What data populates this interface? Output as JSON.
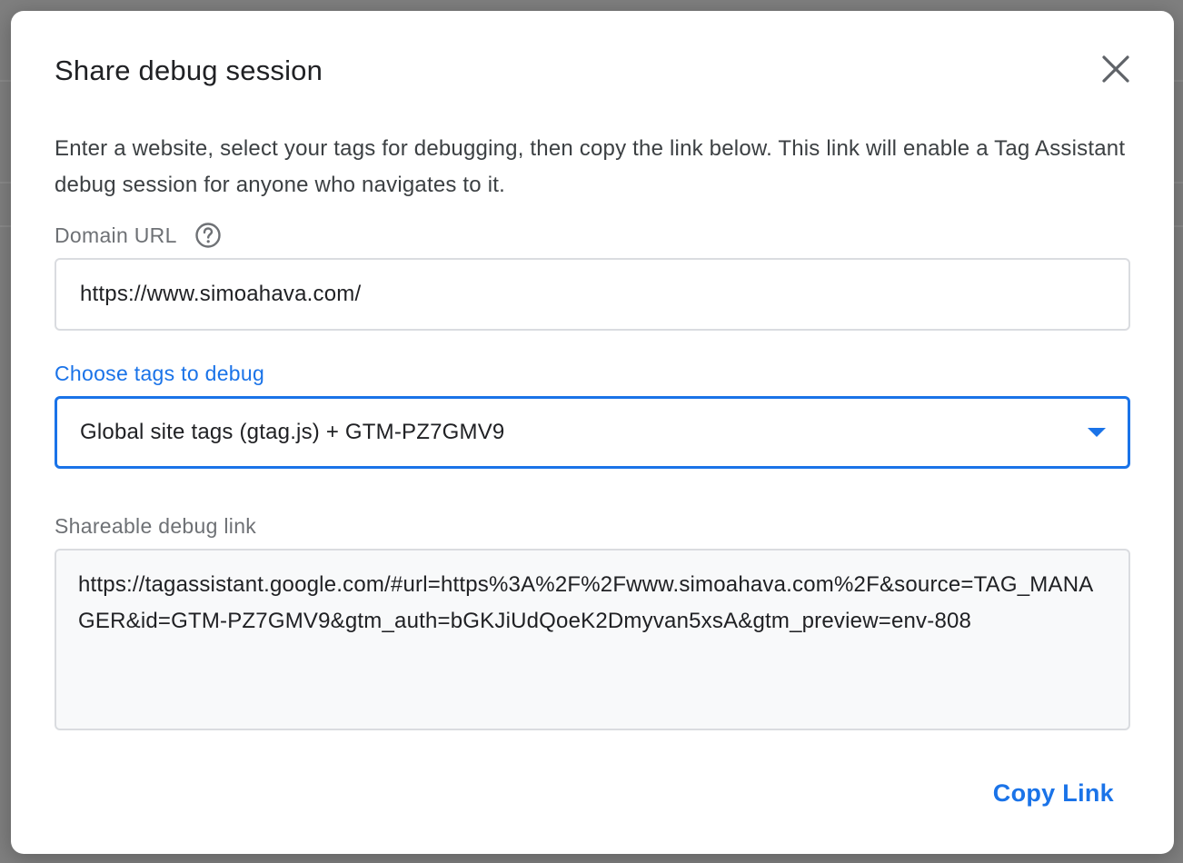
{
  "dialog": {
    "title": "Share debug session",
    "description": "Enter a website, select your tags for debugging, then copy the link below. This link will enable a Tag Assistant debug session for anyone who navigates to it.",
    "domain_label": "Domain URL",
    "domain_value": "https://www.simoahava.com/",
    "tags_label": "Choose tags to debug",
    "tags_selected": "Global site tags (gtag.js) + GTM-PZ7GMV9",
    "link_label": "Shareable debug link",
    "link_value": "https://tagassistant.google.com/#url=https%3A%2F%2Fwww.simoahava.com%2F&source=TAG_MANAGER&id=GTM-PZ7GMV9&gtm_auth=bGKJiUdQoeK2Dmyvan5xsA&gtm_preview=env-808",
    "copy_button": "Copy Link"
  },
  "icons": {
    "close": "close-icon",
    "help": "help-circle-icon",
    "dropdown": "caret-down-icon"
  },
  "colors": {
    "accent": "#1a73e8",
    "overlay": "#7f7f7f",
    "link_box_bg": "#f8f9fa"
  }
}
